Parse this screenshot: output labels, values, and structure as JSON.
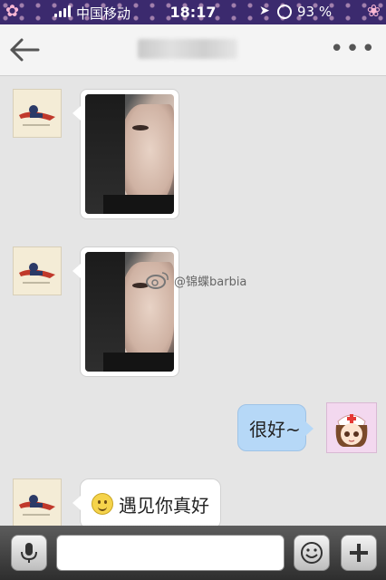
{
  "status_bar": {
    "carrier": "中国移动",
    "time": "18:17",
    "battery": "93 %"
  },
  "header": {
    "back_icon": "back-arrow-icon",
    "more_icon": "more-dots-icon",
    "more_label": "•••"
  },
  "messages": [
    {
      "side": "left",
      "type": "image"
    },
    {
      "side": "left",
      "type": "image"
    },
    {
      "side": "right",
      "type": "text",
      "text": "很好~"
    },
    {
      "side": "left",
      "type": "text",
      "text": "遇见你真好",
      "emoji": "smile-emoji-icon"
    }
  ],
  "watermark": {
    "text": "@锦蝶barbia"
  },
  "input_bar": {
    "voice_icon": "microphone-icon",
    "emoji_icon": "smiley-icon",
    "add_icon": "plus-icon",
    "input_value": ""
  },
  "colors": {
    "sent_bubble": "#b6d8f7",
    "received_bubble": "#ffffff",
    "chat_bg": "#e5e5e5"
  }
}
